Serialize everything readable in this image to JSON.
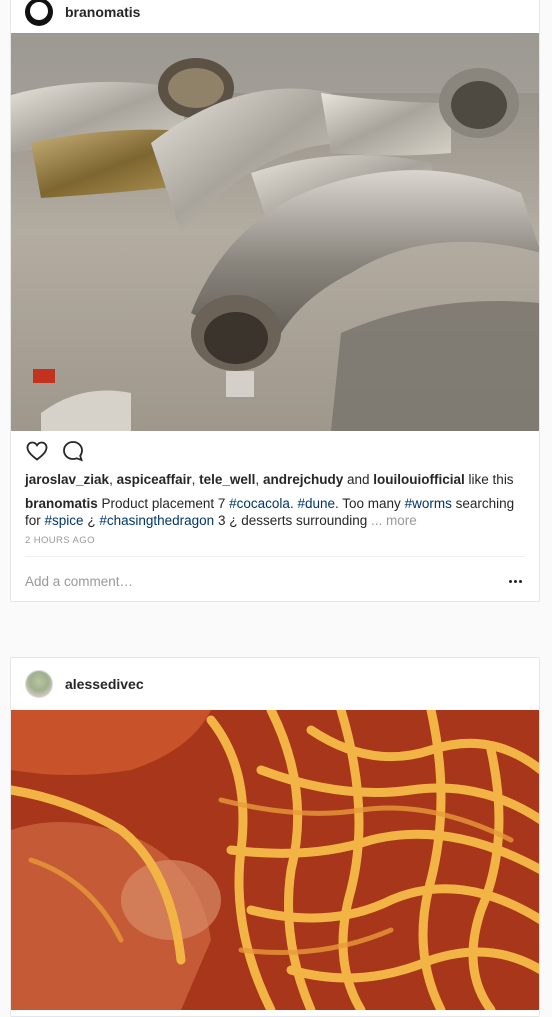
{
  "posts": [
    {
      "username": "branomatis",
      "likes": {
        "users": [
          "jaroslav_ziak",
          "aspiceaffair",
          "tele_well",
          "andrejchudy"
        ],
        "and_text": "and",
        "last_user": "louilouiofficial",
        "suffix": "like this"
      },
      "caption": {
        "author": "branomatis",
        "t1": "Product placement 7",
        "tag1": "#cocacola",
        "t2": ".",
        "tag2": "#dune",
        "t3": ". Too many",
        "tag3": "#worms",
        "t4": "searching for",
        "tag4": "#spice",
        "t5": "¿",
        "tag5": "#chasingthedragon",
        "t6": "3 ¿ desserts surrounding",
        "more": "... more"
      },
      "timestamp": "2 HOURS AGO",
      "comment_placeholder": "Add a comment…"
    },
    {
      "username": "alessedivec"
    }
  ],
  "icons": {
    "like": "heart-icon",
    "comment": "comment-bubble-icon",
    "options": "more-options-icon"
  },
  "colors": {
    "hashtag": "#003569",
    "muted": "#999999",
    "text": "#262626",
    "page_bg": "#fafafa"
  }
}
